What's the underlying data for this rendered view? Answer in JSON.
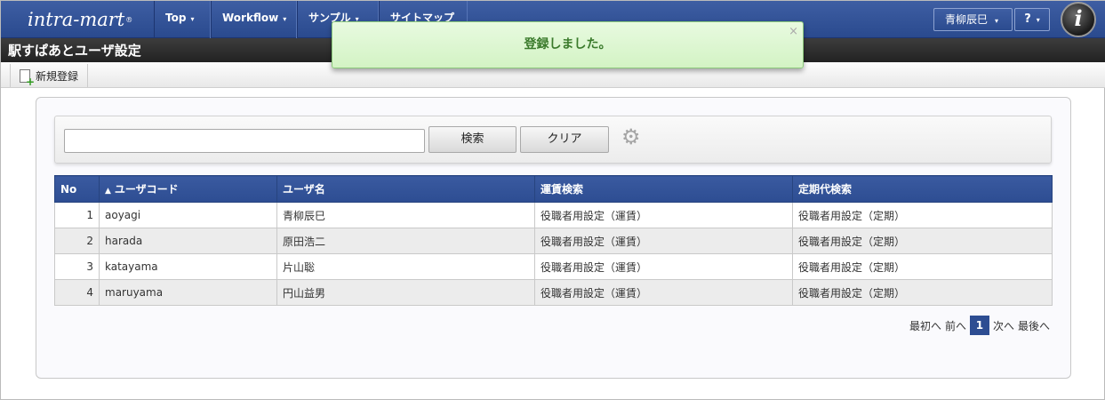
{
  "header": {
    "logo_text": "intra-mart",
    "logo_mark": "®",
    "nav": [
      {
        "label": "Top",
        "caret": "▾"
      },
      {
        "label": "Workflow",
        "caret": "▾"
      },
      {
        "label": "サンプル",
        "caret": "▾"
      },
      {
        "label": "サイトマップ",
        "caret": ""
      }
    ],
    "user_name": "青柳辰巳",
    "help_label": "?",
    "caret": "▾",
    "brand_icon": "i"
  },
  "page": {
    "title": "駅すぱあとユーザ設定"
  },
  "toolbar": {
    "new_label": "新規登録"
  },
  "search": {
    "value": "",
    "search_label": "検索",
    "clear_label": "クリア",
    "settings_icon": "gear-icon"
  },
  "table": {
    "sort_indicator": "▲",
    "headers": [
      "No",
      "ユーザコード",
      "ユーザ名",
      "運賃検索",
      "定期代検索"
    ],
    "rows": [
      {
        "no": "1",
        "code": "aoyagi",
        "name": "青柳辰巳",
        "fare": "役職者用設定（運賃）",
        "pass": "役職者用設定（定期）"
      },
      {
        "no": "2",
        "code": "harada",
        "name": "原田浩二",
        "fare": "役職者用設定（運賃）",
        "pass": "役職者用設定（定期）"
      },
      {
        "no": "3",
        "code": "katayama",
        "name": "片山聡",
        "fare": "役職者用設定（運賃）",
        "pass": "役職者用設定（定期）"
      },
      {
        "no": "4",
        "code": "maruyama",
        "name": "円山益男",
        "fare": "役職者用設定（運賃）",
        "pass": "役職者用設定（定期）"
      }
    ]
  },
  "pager": {
    "first": "最初へ",
    "prev": "前へ",
    "current": "1",
    "next": "次へ",
    "last": "最後へ"
  },
  "toast": {
    "message": "登録しました。",
    "close": "×"
  },
  "colors": {
    "nav_blue": "#2d4d92",
    "title_bar": "#2a2a2a",
    "toast_green": "#d8f5c9",
    "toast_text": "#3a7a2b"
  }
}
